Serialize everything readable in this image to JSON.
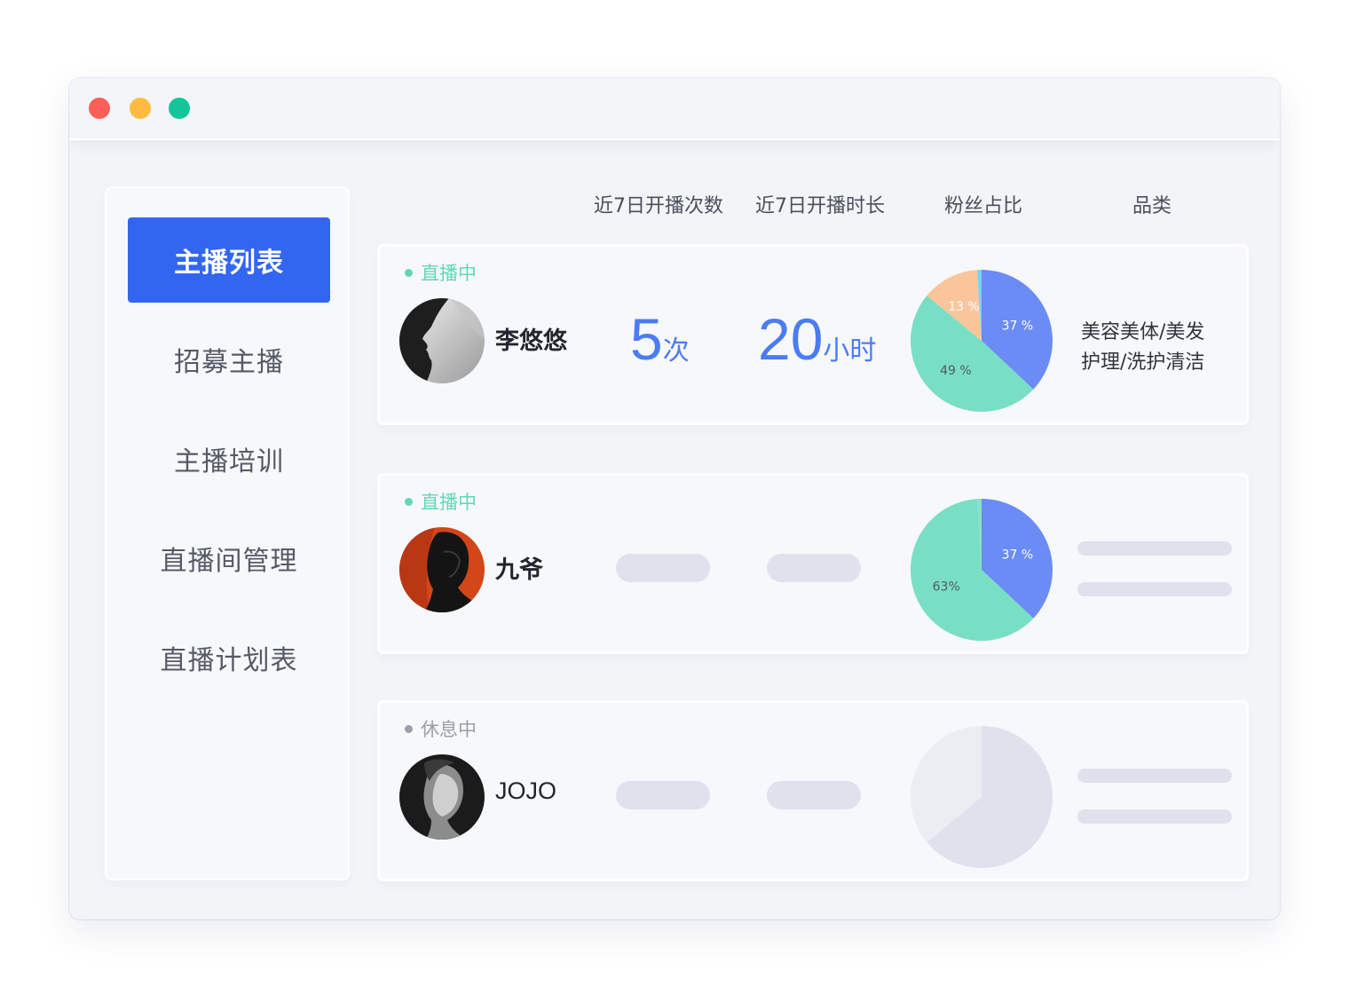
{
  "window": {
    "controls": [
      {
        "name": "close",
        "color": "#fd5f57"
      },
      {
        "name": "minimize",
        "color": "#fdbc41"
      },
      {
        "name": "maximize",
        "color": "#12c69a"
      }
    ]
  },
  "sidebar": {
    "items": [
      {
        "label": "主播列表",
        "active": true
      },
      {
        "label": "招募主播",
        "active": false
      },
      {
        "label": "主播培训",
        "active": false
      },
      {
        "label": "直播间管理",
        "active": false
      },
      {
        "label": "直播计划表",
        "active": false
      }
    ]
  },
  "columns": {
    "sessions": "近7日开播次数",
    "duration": "近7日开播时长",
    "fans": "粉丝占比",
    "category": "品类"
  },
  "colors": {
    "accent": "#3366f0",
    "metric": "#4a7cf2",
    "live": "#62d7b6",
    "resting": "#9a9fab",
    "pie_blue": "#6b8cf4",
    "pie_green": "#79dfc4",
    "pie_orange": "#fbc59b",
    "pie_cyan": "#6fd7f3",
    "placeholder": "#dfe2ec"
  },
  "streamers": [
    {
      "status": "直播中",
      "status_type": "live",
      "name": "李悠悠",
      "avatar_icon": "woman-profile-avatar",
      "sessions_value": "5",
      "sessions_unit": "次",
      "duration_value": "20",
      "duration_unit": "小时",
      "fans_pie": [
        {
          "value": 37,
          "label": "37 %",
          "color": "#6b8cf4"
        },
        {
          "value": 49,
          "label": "49 %",
          "color": "#79dfc4"
        },
        {
          "value": 13,
          "label": "13 %",
          "color": "#fbc59b"
        },
        {
          "value": 1,
          "label": "",
          "color": "#6fd7f3"
        }
      ],
      "category_line1": "美容美体/美发",
      "category_line2": "护理/洗护清洁"
    },
    {
      "status": "直播中",
      "status_type": "live",
      "name": "九爷",
      "avatar_icon": "man-portrait-avatar",
      "fans_pie": [
        {
          "value": 37,
          "label": "37 %",
          "color": "#6b8cf4"
        },
        {
          "value": 62,
          "label": "63%",
          "color": "#79dfc4"
        },
        {
          "value": 1,
          "label": "",
          "color": "#86e2ca"
        }
      ]
    },
    {
      "status": "休息中",
      "status_type": "resting",
      "name": "JOJO",
      "avatar_icon": "woman-portrait-avatar",
      "fans_pie": [
        {
          "value": 64,
          "label": "",
          "color": "#dfe2ec"
        },
        {
          "value": 36,
          "label": "",
          "color": "#ebedf3"
        }
      ]
    }
  ]
}
